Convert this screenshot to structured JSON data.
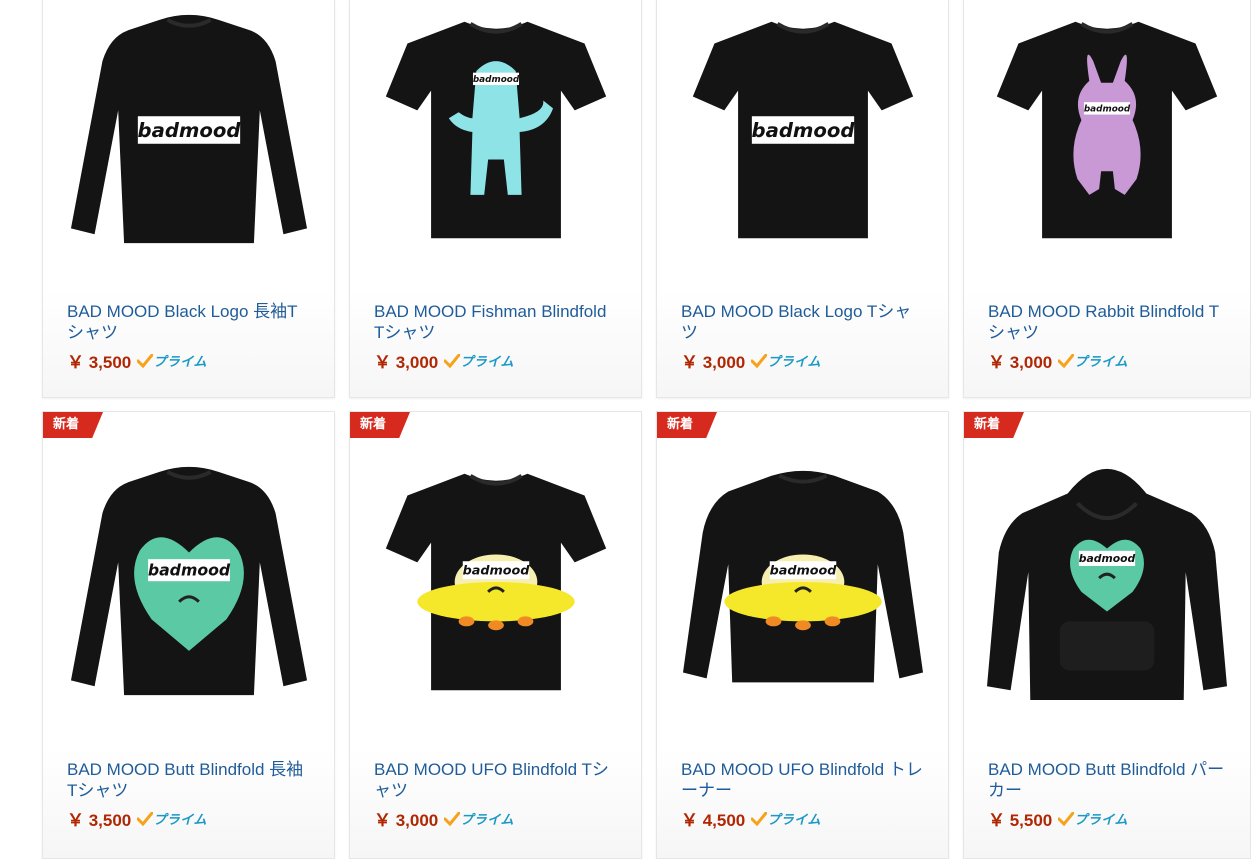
{
  "prime_label": "プライム",
  "products": [
    {
      "title": "BAD MOOD Black Logo 長袖Tシャツ",
      "price": "￥ 3,500",
      "badge": "",
      "image": "longsleeve-logo"
    },
    {
      "title": "BAD MOOD Fishman Blindfold Tシャツ",
      "price": "￥ 3,000",
      "badge": "",
      "image": "tshirt-fishman"
    },
    {
      "title": "BAD MOOD Black Logo Tシャツ",
      "price": "￥ 3,000",
      "badge": "",
      "image": "tshirt-logo"
    },
    {
      "title": "BAD MOOD Rabbit Blindfold Tシャツ",
      "price": "￥ 3,000",
      "badge": "",
      "image": "tshirt-rabbit"
    },
    {
      "title": "BAD MOOD Butt Blindfold 長袖Tシャツ",
      "price": "￥ 3,500",
      "badge": "新着",
      "image": "longsleeve-butt"
    },
    {
      "title": "BAD MOOD UFO Blindfold Tシャツ",
      "price": "￥ 3,000",
      "badge": "新着",
      "image": "tshirt-ufo"
    },
    {
      "title": "BAD MOOD UFO Blindfold トレーナー",
      "price": "￥ 4,500",
      "badge": "新着",
      "image": "sweatshirt-ufo"
    },
    {
      "title": "BAD MOOD Butt Blindfold パーカー",
      "price": "￥ 5,500",
      "badge": "新着",
      "image": "hoodie-butt"
    }
  ],
  "logo_text": "badmood",
  "colors": {
    "link": "#1f5c99",
    "price": "#b12704",
    "prime": "#1a98c7",
    "check": "#f7a21b",
    "badge": "#d62a1e",
    "garment": "#141414",
    "fishman": "#8ee3e6",
    "rabbit": "#c999d6",
    "butt": "#5cc9a5",
    "ufo": "#f5e72a"
  }
}
